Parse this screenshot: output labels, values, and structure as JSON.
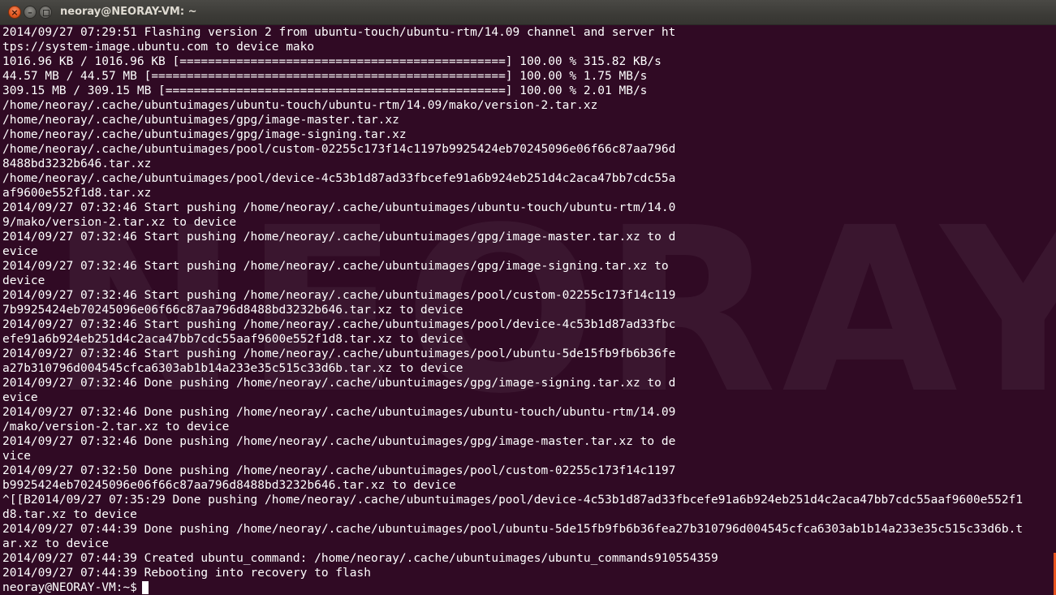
{
  "window": {
    "title": "neoray@NEORAY-VM: ~",
    "close_label": "×",
    "min_label": "–"
  },
  "watermark": "NEORAY",
  "terminal": {
    "lines": [
      "2014/09/27 07:29:51 Flashing version 2 from ubuntu-touch/ubuntu-rtm/14.09 channel and server ht",
      "tps://system-image.ubuntu.com to device mako",
      "1016.96 KB / 1016.96 KB [==============================================] 100.00 % 315.82 KB/s",
      "44.57 MB / 44.57 MB [==================================================] 100.00 % 1.75 MB/s",
      "309.15 MB / 309.15 MB [================================================] 100.00 % 2.01 MB/s",
      "/home/neoray/.cache/ubuntuimages/ubuntu-touch/ubuntu-rtm/14.09/mako/version-2.tar.xz",
      "/home/neoray/.cache/ubuntuimages/gpg/image-master.tar.xz",
      "/home/neoray/.cache/ubuntuimages/gpg/image-signing.tar.xz",
      "/home/neoray/.cache/ubuntuimages/pool/custom-02255c173f14c1197b9925424eb70245096e06f66c87aa796d",
      "8488bd3232b646.tar.xz",
      "/home/neoray/.cache/ubuntuimages/pool/device-4c53b1d87ad33fbcefe91a6b924eb251d4c2aca47bb7cdc55a",
      "af9600e552f1d8.tar.xz",
      "2014/09/27 07:32:46 Start pushing /home/neoray/.cache/ubuntuimages/ubuntu-touch/ubuntu-rtm/14.0",
      "9/mako/version-2.tar.xz to device",
      "2014/09/27 07:32:46 Start pushing /home/neoray/.cache/ubuntuimages/gpg/image-master.tar.xz to d",
      "evice",
      "2014/09/27 07:32:46 Start pushing /home/neoray/.cache/ubuntuimages/gpg/image-signing.tar.xz to",
      "device",
      "2014/09/27 07:32:46 Start pushing /home/neoray/.cache/ubuntuimages/pool/custom-02255c173f14c119",
      "7b9925424eb70245096e06f66c87aa796d8488bd3232b646.tar.xz to device",
      "2014/09/27 07:32:46 Start pushing /home/neoray/.cache/ubuntuimages/pool/device-4c53b1d87ad33fbc",
      "efe91a6b924eb251d4c2aca47bb7cdc55aaf9600e552f1d8.tar.xz to device",
      "2014/09/27 07:32:46 Start pushing /home/neoray/.cache/ubuntuimages/pool/ubuntu-5de15fb9fb6b36fe",
      "a27b310796d004545cfca6303ab1b14a233e35c515c33d6b.tar.xz to device",
      "2014/09/27 07:32:46 Done pushing /home/neoray/.cache/ubuntuimages/gpg/image-signing.tar.xz to d",
      "evice",
      "2014/09/27 07:32:46 Done pushing /home/neoray/.cache/ubuntuimages/ubuntu-touch/ubuntu-rtm/14.09",
      "/mako/version-2.tar.xz to device",
      "2014/09/27 07:32:46 Done pushing /home/neoray/.cache/ubuntuimages/gpg/image-master.tar.xz to de",
      "vice",
      "2014/09/27 07:32:50 Done pushing /home/neoray/.cache/ubuntuimages/pool/custom-02255c173f14c1197",
      "b9925424eb70245096e06f66c87aa796d8488bd3232b646.tar.xz to device",
      "^[[B2014/09/27 07:35:29 Done pushing /home/neoray/.cache/ubuntuimages/pool/device-4c53b1d87ad33fbcefe91a6b924eb251d4c2aca47bb7cdc55aaf9600e552f1",
      "d8.tar.xz to device",
      "2014/09/27 07:44:39 Done pushing /home/neoray/.cache/ubuntuimages/pool/ubuntu-5de15fb9fb6b36fea27b310796d004545cfca6303ab1b14a233e35c515c33d6b.t",
      "ar.xz to device",
      "2014/09/27 07:44:39 Created ubuntu_command: /home/neoray/.cache/ubuntuimages/ubuntu_commands910554359",
      "2014/09/27 07:44:39 Rebooting into recovery to flash"
    ],
    "prompt": "neoray@NEORAY-VM:~$"
  }
}
